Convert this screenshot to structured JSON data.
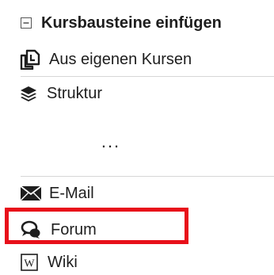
{
  "panel": {
    "header": {
      "title": "Kursbausteine einfügen",
      "icon": "collapse-minus-icon"
    },
    "items_top": [
      {
        "label": "Aus eigenen Kursen",
        "icon": "copy-icon"
      },
      {
        "label": "Struktur",
        "icon": "layers-icon"
      }
    ],
    "ellipsis": "...",
    "items_bottom": [
      {
        "label": "E-Mail",
        "icon": "envelope-icon"
      },
      {
        "label": "Forum",
        "icon": "forum-chat-icon",
        "highlighted": true
      },
      {
        "label": "Wiki",
        "icon": "wiki-icon"
      }
    ]
  },
  "colors": {
    "text": "#1e1e1e",
    "divider": "#d6d6d6",
    "highlight": "#e8101a"
  }
}
